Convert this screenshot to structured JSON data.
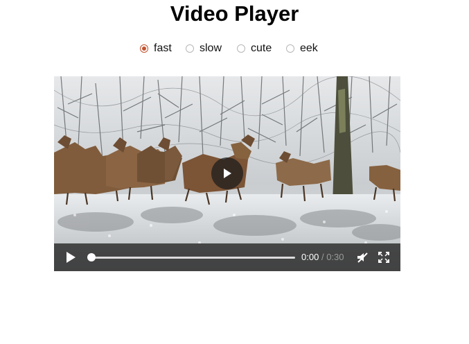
{
  "page": {
    "title": "Video Player"
  },
  "speed_options": [
    {
      "label": "fast",
      "checked": true
    },
    {
      "label": "slow",
      "checked": false
    },
    {
      "label": "cute",
      "checked": false
    },
    {
      "label": "eek",
      "checked": false
    }
  ],
  "player": {
    "current_time": "0:00",
    "separator": "/",
    "duration": "0:30",
    "progress": 0,
    "muted": true
  },
  "colors": {
    "accent": "#c5522e",
    "controls_bg": "#282828"
  },
  "icons": [
    "play-icon",
    "big-play-icon",
    "mute-icon",
    "fullscreen-icon"
  ]
}
